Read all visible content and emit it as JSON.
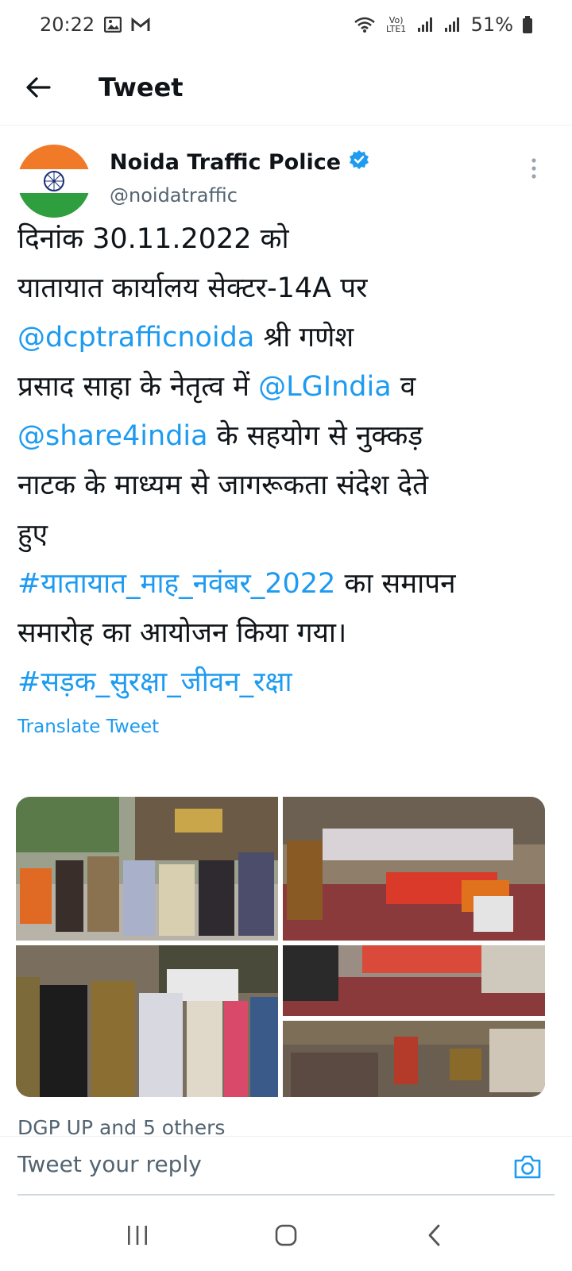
{
  "status_bar": {
    "time": "20:22",
    "icons_left": [
      "gallery-icon",
      "gmail-icon"
    ],
    "icons_right": [
      "wifi-icon",
      "volte-icon",
      "signal-icon",
      "signal-icon",
      "battery-icon"
    ],
    "volte_text": "Vo) LTE1",
    "battery": "51%"
  },
  "header": {
    "title": "Tweet"
  },
  "tweet": {
    "author_name": "Noida Traffic Police",
    "handle": "@noidatraffic",
    "verified": true,
    "body": {
      "l1": "दिनांक 30.11.2022 को",
      "l2": "यातायात कार्यालय सेक्टर-14A पर",
      "l3_link": "@dcptrafficnoida",
      "l3_text": " श्री गणेश",
      "l4_text": "प्रसाद साहा के नेतृत्व में ",
      "l4_link": "@LGIndia",
      "l4_tail": " व",
      "l5_link": "@share4india",
      "l5_text": " के सहयोग से नुक्कड़",
      "l6": "नाटक के माध्यम से जागरूकता संदेश देते",
      "l7": "हुए",
      "l8_link": "#यातायात_माह_नवंबर_2022",
      "l8_text": " का समापन",
      "l9": "समारोह का आयोजन किया गया।",
      "l10_link": "#सड़क_सुरक्षा_जीवन_रक्षा"
    },
    "translate_label": "Translate Tweet",
    "engagement_text": "DGP UP and 5 others"
  },
  "reply": {
    "placeholder": "Tweet your reply"
  },
  "colors": {
    "link": "#1d9bf0",
    "secondary_text": "#536471",
    "verified": "#1d9bf0"
  }
}
